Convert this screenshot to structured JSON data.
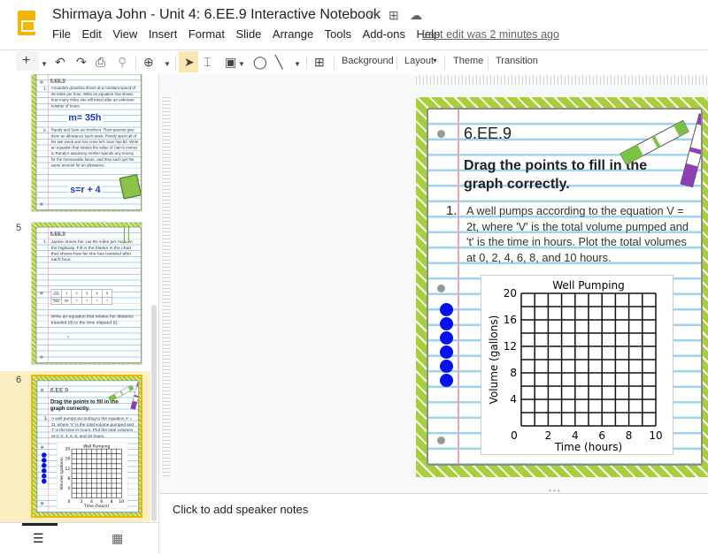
{
  "app": {
    "title": "Shirmaya John - Unit 4: 6.EE.9 Interactive Notebook",
    "last_edit": "Last edit was 2 minutes ago",
    "menu": [
      "File",
      "Edit",
      "View",
      "Insert",
      "Format",
      "Slide",
      "Arrange",
      "Tools",
      "Add-ons",
      "Help"
    ]
  },
  "toolbar": {
    "background": "Background",
    "layout": "Layout",
    "theme": "Theme",
    "transition": "Transition"
  },
  "filmstrip": {
    "slide5_num": "5",
    "slide6_num": "6"
  },
  "slide4": {
    "code": "6.EE.9",
    "q1_num": "1.",
    "q1": "Amanda's grandma drives at a constant speed of 35 miles per hour. Write an equation that shows how many miles she will travel after an unknown number of hours.",
    "a1": "m= 35h",
    "q2_num": "2.",
    "q2": "Randy and Sam are brothers. Their parents give them an allowance each week. Randy spent all of his last week and has none left. Sam has $4. Write an equation that relates the value of Sam's money to Randy's assuming neither spends any money for the foreseeable future, and they each get the same amount for an allowance.",
    "a2": "s=r + 4"
  },
  "slide5": {
    "code": "6.EE.9",
    "q1_num": "1.",
    "q1": "Jackie drives her car 65 miles per hour on the highway. Fill in the blanks in the chart that shows how far she has traveled after each hour.",
    "table": {
      "row1": [
        "Time (hours)",
        "1",
        "2",
        "3",
        "4",
        "5"
      ],
      "row2": [
        "Distance (miles)",
        "65",
        "?",
        "?",
        "?",
        "?"
      ]
    },
    "q2": "Write an equation that relates her distance traveled (d) to the time elapsed (t).",
    "a2": "?"
  },
  "slide6": {
    "code": "6.EE.9",
    "title": "Drag the points to fill in the graph correctly.",
    "num": "1.",
    "text": "A well pumps according to the equation V = 2t, where 'V' is the total volume pumped and 't' is the time in hours.  Plot the total volumes at 0, 2, 4, 6, 8, and 10 hours.",
    "draggable_points": 6,
    "point_color": "#0011ee"
  },
  "chart_data": {
    "type": "scatter",
    "title": "Well Pumping",
    "xlabel": "Time (hours)",
    "ylabel": "Volume (gallons)",
    "xlim": [
      0,
      10
    ],
    "ylim": [
      0,
      20
    ],
    "xticks": [
      0,
      2,
      4,
      6,
      8,
      10
    ],
    "yticks": [
      0,
      4,
      8,
      12,
      16,
      20
    ],
    "grid": true,
    "grid_x_step": 1,
    "grid_y_step": 2,
    "points": []
  },
  "notes": {
    "placeholder": "Click to add speaker notes"
  },
  "colors": {
    "accent_border": "#a8cf3a",
    "selected_slide_bg": "#fdefc3",
    "logo": "#f4b400"
  }
}
